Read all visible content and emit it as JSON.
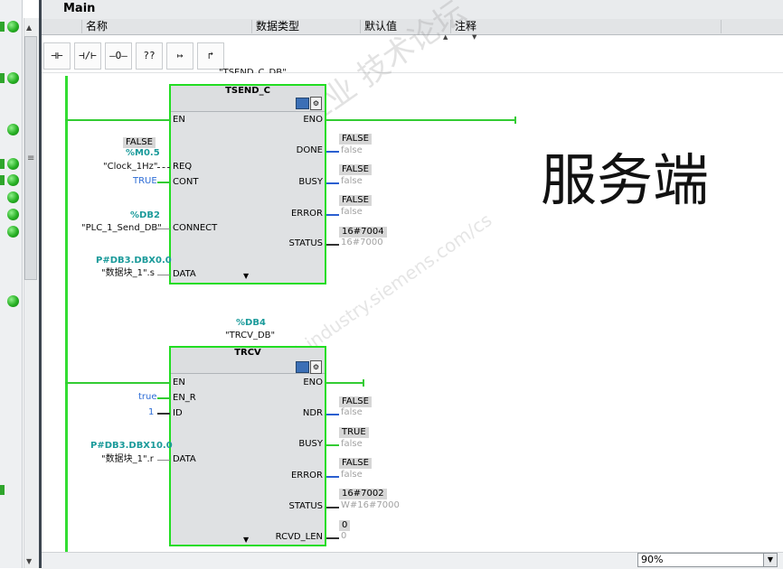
{
  "editor": {
    "block_title": "Main",
    "columns": [
      "名称",
      "数据类型",
      "默认值",
      "注释"
    ],
    "zoom_value": "90%"
  },
  "toolbar": {
    "contact_no": "⊣⊢",
    "contact_nc": "⊣/⊢",
    "coil": "–O–",
    "empty_box": "??",
    "open_branch": "↦",
    "close_branch": "↱"
  },
  "network1": {
    "top_label_cut": "\"TSEND_C_DB\"",
    "block_name": "TSEND_C",
    "inputs": {
      "en": "EN",
      "req": "REQ",
      "cont": "CONT",
      "connect": "CONNECT",
      "data": "DATA"
    },
    "outputs": {
      "eno": "ENO",
      "done": "DONE",
      "busy": "BUSY",
      "error": "ERROR",
      "status": "STATUS"
    },
    "req_monitor": "FALSE",
    "req_addr": "%M0.5",
    "req_sym": "\"Clock_1Hz\"",
    "cont_value": "TRUE",
    "connect_addr": "%DB2",
    "connect_sym": "\"PLC_1_Send_DB\"",
    "data_addr": "P#DB3.DBX0.0",
    "data_sym": "\"数据块_1\".s",
    "done_monitor": "FALSE",
    "done_value": "false",
    "busy_monitor": "FALSE",
    "busy_value": "false",
    "error_monitor": "FALSE",
    "error_value": "false",
    "status_monitor": "16#7004",
    "status_value": "16#7000"
  },
  "network2": {
    "instance_addr": "%DB4",
    "instance_sym": "\"TRCV_DB\"",
    "block_name": "TRCV",
    "inputs": {
      "en": "EN",
      "en_r": "EN_R",
      "id": "ID",
      "data": "DATA"
    },
    "outputs": {
      "eno": "ENO",
      "ndr": "NDR",
      "busy": "BUSY",
      "error": "ERROR",
      "status": "STATUS",
      "rcvd_len": "RCVD_LEN"
    },
    "en_r_value": "true",
    "id_value": "1",
    "data_addr": "P#DB3.DBX10.0",
    "data_sym": "\"数据块_1\".r",
    "ndr_monitor": "FALSE",
    "ndr_value": "false",
    "busy_monitor": "TRUE",
    "busy_value": "false",
    "error_monitor": "FALSE",
    "error_value": "false",
    "status_monitor": "16#7002",
    "status_value": "W#16#7000",
    "rcvd_len_monitor": "0",
    "rcvd_len_value": "0"
  },
  "annotation": {
    "big_text": "服务端"
  },
  "watermark": {
    "line1": "西门子工业 技术论坛",
    "line2": "support.industry.siemens.com/cs"
  },
  "colors": {
    "rail": "#33dd33",
    "block_border": "#22dd22",
    "address": "#1a9a9a",
    "status_led": "#26b023"
  }
}
